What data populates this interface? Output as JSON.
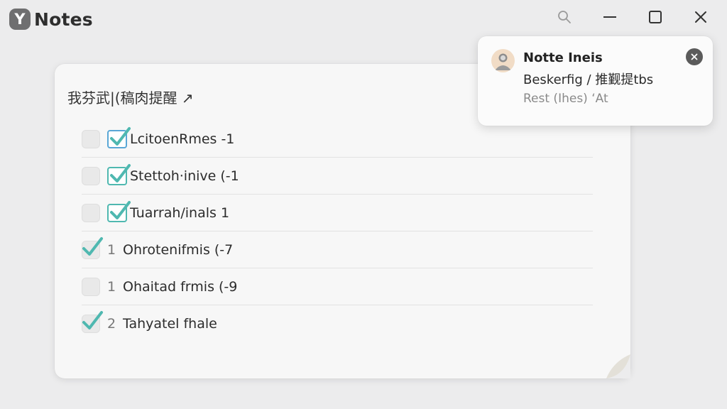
{
  "app": {
    "logo_letter": "Y",
    "title": "Notes"
  },
  "window_controls": {
    "search_icon": "search-icon",
    "minimize_icon": "minimize-icon",
    "maximize_icon": "maximize-icon",
    "close_icon": "close-icon"
  },
  "note": {
    "title": "我芬武|(稿肉提醒 ↗",
    "tasks": [
      {
        "number": "",
        "text": "LcitoenRmes -1",
        "checked_left": false,
        "second_check": "blue"
      },
      {
        "number": "",
        "text": "Stettoh·inive (-1",
        "checked_left": false,
        "second_check": "teal"
      },
      {
        "number": "",
        "text": "Tuarrah/inals 1",
        "checked_left": false,
        "second_check": "teal"
      },
      {
        "number": "1",
        "text": "Ohrotenifmis (-7",
        "checked_left": true,
        "second_check": "none"
      },
      {
        "number": "1",
        "text": "Ohaitad frmis (-9",
        "checked_left": false,
        "second_check": "none"
      },
      {
        "number": "2",
        "text": "Tahyatel fhale",
        "checked_left": true,
        "second_check": "none"
      }
    ]
  },
  "notification": {
    "title": "Notte Ineis",
    "body": "Beskerfig / 推觐提tbs",
    "meta": "Rest (Ihes) ‘At",
    "avatar_icon": "user-avatar-icon",
    "close_icon": "close-icon"
  },
  "colors": {
    "background": "#ececed",
    "card": "#f7f7f7",
    "check_teal": "#4fb8b0",
    "check_blue": "#5aa7d6"
  }
}
